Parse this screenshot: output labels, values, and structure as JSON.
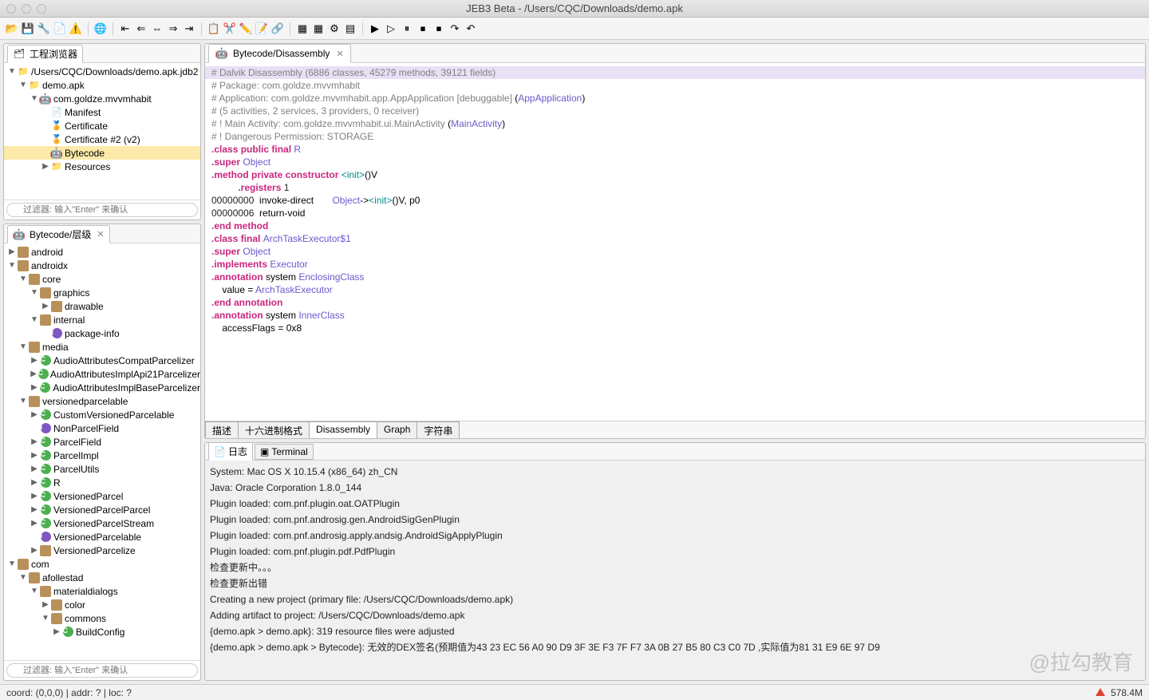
{
  "title": "JEB3 Beta - /Users/CQC/Downloads/demo.apk",
  "projectBrowser": {
    "title": "工程浏览器",
    "filterPlaceholder": "过滤器: 输入\"Enter\" 来确认",
    "items": [
      {
        "depth": 0,
        "tw": "▼",
        "icon": "folder",
        "label": "/Users/CQC/Downloads/demo.apk.jdb2"
      },
      {
        "depth": 1,
        "tw": "▼",
        "icon": "folder",
        "label": "demo.apk"
      },
      {
        "depth": 2,
        "tw": "▼",
        "icon": "android",
        "label": "com.goldze.mvvmhabit"
      },
      {
        "depth": 3,
        "tw": "",
        "icon": "file-x",
        "label": "Manifest"
      },
      {
        "depth": 3,
        "tw": "",
        "icon": "cert",
        "label": "Certificate"
      },
      {
        "depth": 3,
        "tw": "",
        "icon": "cert",
        "label": "Certificate #2 (v2)"
      },
      {
        "depth": 3,
        "tw": "",
        "icon": "android",
        "label": "Bytecode",
        "sel": true
      },
      {
        "depth": 3,
        "tw": "▶",
        "icon": "folder",
        "label": "Resources"
      }
    ]
  },
  "hierarchy": {
    "title": "Bytecode/层级",
    "filterPlaceholder": "过滤器: 输入\"Enter\" 来确认",
    "items": [
      {
        "depth": 0,
        "tw": "▶",
        "icon": "pkg",
        "label": "android"
      },
      {
        "depth": 0,
        "tw": "▼",
        "icon": "pkg",
        "label": "androidx"
      },
      {
        "depth": 1,
        "tw": "▼",
        "icon": "pkg",
        "label": "core"
      },
      {
        "depth": 2,
        "tw": "▼",
        "icon": "pkg",
        "label": "graphics"
      },
      {
        "depth": 3,
        "tw": "▶",
        "icon": "pkg",
        "label": "drawable"
      },
      {
        "depth": 2,
        "tw": "▼",
        "icon": "pkg",
        "label": "internal"
      },
      {
        "depth": 3,
        "tw": "",
        "icon": "interface",
        "label": "package-info"
      },
      {
        "depth": 1,
        "tw": "▼",
        "icon": "pkg",
        "label": "media"
      },
      {
        "depth": 2,
        "tw": "▶",
        "icon": "class",
        "label": "AudioAttributesCompatParcelizer"
      },
      {
        "depth": 2,
        "tw": "▶",
        "icon": "class",
        "label": "AudioAttributesImplApi21Parcelizer"
      },
      {
        "depth": 2,
        "tw": "▶",
        "icon": "class",
        "label": "AudioAttributesImplBaseParcelizer"
      },
      {
        "depth": 1,
        "tw": "▼",
        "icon": "pkg",
        "label": "versionedparcelable"
      },
      {
        "depth": 2,
        "tw": "▶",
        "icon": "class",
        "label": "CustomVersionedParcelable"
      },
      {
        "depth": 2,
        "tw": "",
        "icon": "interface",
        "label": "NonParcelField"
      },
      {
        "depth": 2,
        "tw": "▶",
        "icon": "class",
        "label": "ParcelField"
      },
      {
        "depth": 2,
        "tw": "▶",
        "icon": "class",
        "label": "ParcelImpl"
      },
      {
        "depth": 2,
        "tw": "▶",
        "icon": "class",
        "label": "ParcelUtils"
      },
      {
        "depth": 2,
        "tw": "▶",
        "icon": "class",
        "label": "R"
      },
      {
        "depth": 2,
        "tw": "▶",
        "icon": "class",
        "label": "VersionedParcel"
      },
      {
        "depth": 2,
        "tw": "▶",
        "icon": "class",
        "label": "VersionedParcelParcel"
      },
      {
        "depth": 2,
        "tw": "▶",
        "icon": "class",
        "label": "VersionedParcelStream"
      },
      {
        "depth": 2,
        "tw": "",
        "icon": "interface",
        "label": "VersionedParcelable"
      },
      {
        "depth": 2,
        "tw": "▶",
        "icon": "pkg",
        "label": "VersionedParcelize"
      },
      {
        "depth": 0,
        "tw": "▼",
        "icon": "pkg",
        "label": "com"
      },
      {
        "depth": 1,
        "tw": "▼",
        "icon": "pkg",
        "label": "afollestad"
      },
      {
        "depth": 2,
        "tw": "▼",
        "icon": "pkg",
        "label": "materialdialogs"
      },
      {
        "depth": 3,
        "tw": "▶",
        "icon": "pkg",
        "label": "color"
      },
      {
        "depth": 3,
        "tw": "▼",
        "icon": "pkg",
        "label": "commons"
      },
      {
        "depth": 4,
        "tw": "▶",
        "icon": "class",
        "label": "BuildConfig"
      }
    ]
  },
  "editor": {
    "tabTitle": "Bytecode/Disassembly",
    "bottomTabs": [
      "描述",
      "十六进制格式",
      "Disassembly",
      "Graph",
      "字符串"
    ],
    "activeBottom": 2,
    "lines": [
      {
        "hl": true,
        "spans": [
          {
            "c": "cmt",
            "t": "# Dalvik Disassembly (6886 classes, 45279 methods, 39121 fields)"
          }
        ]
      },
      {
        "spans": [
          {
            "c": "cmt",
            "t": "# Package: com.goldze.mvvmhabit"
          }
        ]
      },
      {
        "spans": [
          {
            "c": "cmt",
            "t": "# Application: com.goldze.mvvmhabit.app.AppApplication [debuggable] "
          },
          {
            "c": "",
            "t": "("
          },
          {
            "c": "type",
            "t": "AppApplication"
          },
          {
            "c": "",
            "t": ")"
          }
        ]
      },
      {
        "spans": [
          {
            "c": "cmt",
            "t": "# (5 activities, 2 services, 3 providers, 0 receiver)"
          }
        ]
      },
      {
        "spans": [
          {
            "c": "cmt",
            "t": "# ! Main Activity: com.goldze.mvvmhabit.ui.MainActivity "
          },
          {
            "c": "",
            "t": "("
          },
          {
            "c": "type",
            "t": "MainActivity"
          },
          {
            "c": "",
            "t": ")"
          }
        ]
      },
      {
        "spans": [
          {
            "c": "cmt",
            "t": "# ! Dangerous Permission: STORAGE"
          }
        ]
      },
      {
        "spans": [
          {
            "c": "",
            "t": ""
          }
        ]
      },
      {
        "spans": [
          {
            "c": "kw",
            "t": ".class public final "
          },
          {
            "c": "type",
            "t": "R"
          }
        ]
      },
      {
        "spans": [
          {
            "c": "kw",
            "t": ".super "
          },
          {
            "c": "type",
            "t": "Object"
          }
        ]
      },
      {
        "spans": [
          {
            "c": "",
            "t": ""
          }
        ]
      },
      {
        "spans": [
          {
            "c": "kw",
            "t": ".method private constructor "
          },
          {
            "c": "dir",
            "t": "<init>"
          },
          {
            "c": "",
            "t": "()V"
          }
        ]
      },
      {
        "spans": [
          {
            "c": "",
            "t": "          "
          },
          {
            "c": "kw",
            "t": ".registers "
          },
          {
            "c": "num",
            "t": "1"
          }
        ]
      },
      {
        "spans": [
          {
            "c": "num",
            "t": "00000000"
          },
          {
            "c": "",
            "t": "  invoke-direct       "
          },
          {
            "c": "type",
            "t": "Object"
          },
          {
            "c": "",
            "t": "->"
          },
          {
            "c": "dir",
            "t": "<init>"
          },
          {
            "c": "",
            "t": "()V, p0"
          }
        ]
      },
      {
        "spans": [
          {
            "c": "num",
            "t": "00000006"
          },
          {
            "c": "",
            "t": "  return-void"
          }
        ]
      },
      {
        "spans": [
          {
            "c": "kw",
            "t": ".end method"
          }
        ]
      },
      {
        "spans": [
          {
            "c": "",
            "t": ""
          }
        ]
      },
      {
        "spans": [
          {
            "c": "kw",
            "t": ".class final "
          },
          {
            "c": "type",
            "t": "ArchTaskExecutor$1"
          }
        ]
      },
      {
        "spans": [
          {
            "c": "kw",
            "t": ".super "
          },
          {
            "c": "type",
            "t": "Object"
          }
        ]
      },
      {
        "spans": [
          {
            "c": "",
            "t": ""
          }
        ]
      },
      {
        "spans": [
          {
            "c": "kw",
            "t": ".implements "
          },
          {
            "c": "type",
            "t": "Executor"
          }
        ]
      },
      {
        "spans": [
          {
            "c": "",
            "t": ""
          }
        ]
      },
      {
        "spans": [
          {
            "c": "kw",
            "t": ".annotation "
          },
          {
            "c": "",
            "t": "system "
          },
          {
            "c": "type",
            "t": "EnclosingClass"
          }
        ]
      },
      {
        "spans": [
          {
            "c": "",
            "t": "    value = "
          },
          {
            "c": "type",
            "t": "ArchTaskExecutor"
          }
        ]
      },
      {
        "spans": [
          {
            "c": "kw",
            "t": ".end annotation"
          }
        ]
      },
      {
        "spans": [
          {
            "c": "",
            "t": ""
          }
        ]
      },
      {
        "spans": [
          {
            "c": "kw",
            "t": ".annotation "
          },
          {
            "c": "",
            "t": "system "
          },
          {
            "c": "type",
            "t": "InnerClass"
          }
        ]
      },
      {
        "spans": [
          {
            "c": "",
            "t": "    accessFlags = 0x8"
          }
        ]
      }
    ]
  },
  "console": {
    "tabs": [
      "日志",
      "Terminal"
    ],
    "lines": [
      "System: Mac OS X 10.15.4 (x86_64) zh_CN",
      "Java: Oracle Corporation 1.8.0_144",
      "Plugin loaded: com.pnf.plugin.oat.OATPlugin",
      "Plugin loaded: com.pnf.androsig.gen.AndroidSigGenPlugin",
      "Plugin loaded: com.pnf.androsig.apply.andsig.AndroidSigApplyPlugin",
      "Plugin loaded: com.pnf.plugin.pdf.PdfPlugin",
      "检查更新中。。。",
      "检查更新出错",
      "Creating a new project (primary file: /Users/CQC/Downloads/demo.apk)",
      "Adding artifact to project: /Users/CQC/Downloads/demo.apk",
      "{demo.apk > demo.apk}: 319 resource files were adjusted",
      "{demo.apk > demo.apk > Bytecode}: 无效的DEX签名(预期值为43 23 EC 56 A0 90 D9 3F 3E F3 7F F7 3A 0B 27 B5 80 C3 C0 7D ,实际值为81 31 E9 6E 97 D9"
    ]
  },
  "status": {
    "coord": "coord: (0,0,0) | addr: ? | loc: ?",
    "mem": "578.4M"
  },
  "watermark": "@拉勾教育",
  "toolbarIcons": [
    "📂",
    "💾",
    "🔧",
    "📄",
    "⚠️",
    "|",
    "🌐",
    "|",
    "⇤",
    "⇐",
    "⇔",
    "⇒",
    "⇥",
    "|",
    "📋",
    "✂️",
    "✏️",
    "📝",
    "🔗",
    "|",
    "▦",
    "▦",
    "⚙",
    "▤",
    "|",
    "▶",
    "▷",
    "⏸",
    "⏹",
    "⏹",
    "↷",
    "↶"
  ]
}
